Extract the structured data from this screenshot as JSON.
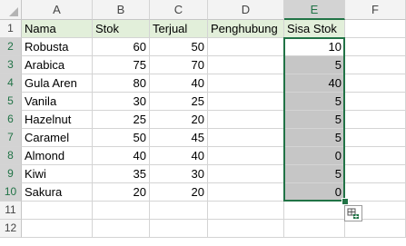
{
  "columns": [
    "A",
    "B",
    "C",
    "D",
    "E",
    "F"
  ],
  "rows": [
    "1",
    "2",
    "3",
    "4",
    "5",
    "6",
    "7",
    "8",
    "9",
    "10",
    "11",
    "12"
  ],
  "headers": {
    "A": "Nama",
    "B": "Stok",
    "C": "Terjual",
    "D": "Penghubung",
    "E": "Sisa Stok"
  },
  "data": [
    {
      "nama": "Robusta",
      "stok": "60",
      "terjual": "50",
      "sisa": "10"
    },
    {
      "nama": "Arabica",
      "stok": "75",
      "terjual": "70",
      "sisa": "5"
    },
    {
      "nama": "Gula Aren",
      "stok": "80",
      "terjual": "40",
      "sisa": "40"
    },
    {
      "nama": "Vanila",
      "stok": "30",
      "terjual": "25",
      "sisa": "5"
    },
    {
      "nama": "Hazelnut",
      "stok": "25",
      "terjual": "20",
      "sisa": "5"
    },
    {
      "nama": "Caramel",
      "stok": "50",
      "terjual": "45",
      "sisa": "5"
    },
    {
      "nama": "Almond",
      "stok": "40",
      "terjual": "40",
      "sisa": "0"
    },
    {
      "nama": "Kiwi",
      "stok": "35",
      "terjual": "30",
      "sisa": "5"
    },
    {
      "nama": "Sakura",
      "stok": "20",
      "terjual": "20",
      "sisa": "0"
    }
  ],
  "selection": {
    "column": "E",
    "first_row": 2,
    "last_row": 10
  },
  "colors": {
    "accent": "#217346",
    "header_fill": "#e2efda",
    "selection_fill": "#c6c6c6"
  },
  "icons": {
    "quick_analysis": "quick-analysis-icon"
  }
}
